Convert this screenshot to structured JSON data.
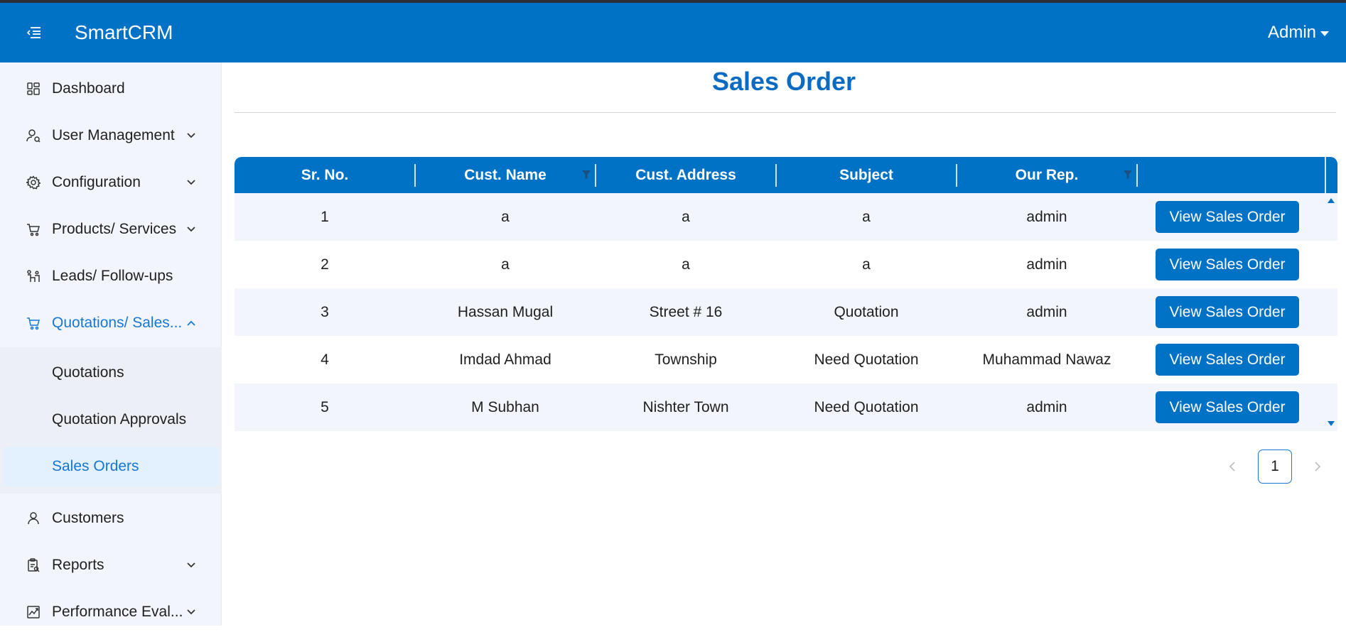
{
  "header": {
    "brand": "SmartCRM",
    "user_label": "Admin",
    "menu_icon": "menu-collapse-icon"
  },
  "sidebar": {
    "items": [
      {
        "label": "Dashboard",
        "icon": "dashboard-icon",
        "expandable": false
      },
      {
        "label": "User Management",
        "icon": "user-management-icon",
        "expandable": true
      },
      {
        "label": "Configuration",
        "icon": "gear-icon",
        "expandable": true
      },
      {
        "label": "Products/ Services",
        "icon": "cart-icon",
        "expandable": true
      },
      {
        "label": "Leads/ Follow-ups",
        "icon": "leads-icon",
        "expandable": false
      },
      {
        "label": "Quotations/ Sales...",
        "icon": "cart-icon",
        "expandable": true,
        "expanded": true
      },
      {
        "label": "Customers",
        "icon": "customer-icon",
        "expandable": false
      },
      {
        "label": "Reports",
        "icon": "report-icon",
        "expandable": true
      },
      {
        "label": "Performance Eval...",
        "icon": "chart-icon",
        "expandable": true
      }
    ],
    "subitems": [
      {
        "label": "Quotations"
      },
      {
        "label": "Quotation Approvals"
      },
      {
        "label": "Sales Orders",
        "selected": true
      }
    ]
  },
  "main": {
    "title": "Sales Order",
    "table": {
      "columns": [
        "Sr. No.",
        "Cust. Name",
        "Cust. Address",
        "Subject",
        "Our Rep.",
        ""
      ],
      "rows": [
        {
          "sr": "1",
          "name": "a",
          "address": "a",
          "subject": "a",
          "rep": "admin",
          "action": "View Sales Order"
        },
        {
          "sr": "2",
          "name": "a",
          "address": "a",
          "subject": "a",
          "rep": "admin",
          "action": "View Sales Order"
        },
        {
          "sr": "3",
          "name": "Hassan Mugal",
          "address": "Street # 16",
          "subject": "Quotation",
          "rep": "admin",
          "action": "View Sales Order"
        },
        {
          "sr": "4",
          "name": "Imdad Ahmad",
          "address": "Township",
          "subject": "Need Quotation",
          "rep": "Muhammad Nawaz",
          "action": "View Sales Order"
        },
        {
          "sr": "5",
          "name": "M Subhan",
          "address": "Nishter Town",
          "subject": "Need Quotation",
          "rep": "admin",
          "action": "View Sales Order"
        }
      ]
    },
    "pagination": {
      "current_page": "1"
    }
  },
  "colors": {
    "primary": "#0072c6",
    "active_text": "#1677d6",
    "sidebar_bg": "#f2f6fc",
    "row_alt_bg": "#f2f6fc"
  }
}
